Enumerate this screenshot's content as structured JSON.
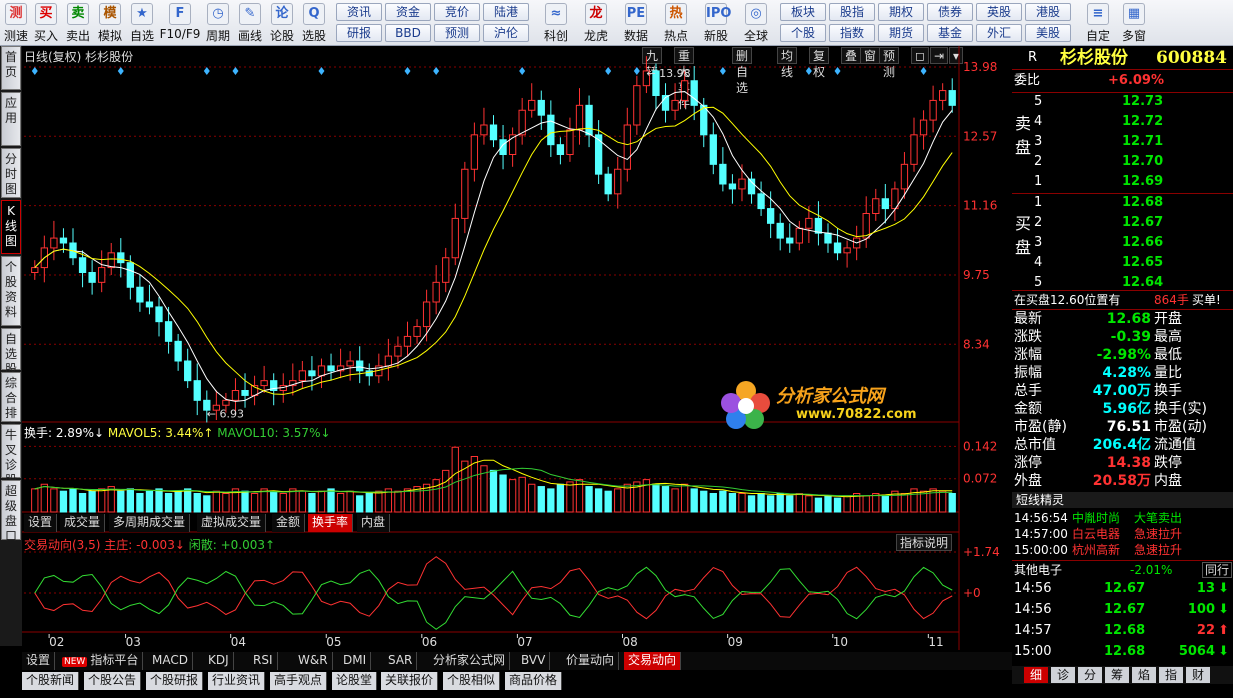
{
  "toolbar": {
    "tools": [
      {
        "icon": "测",
        "label": "测速",
        "color": "#d33"
      },
      {
        "icon": "买",
        "label": "买入",
        "color": "#d00"
      },
      {
        "icon": "卖",
        "label": "卖出",
        "color": "#080"
      },
      {
        "icon": "模",
        "label": "模拟",
        "color": "#a50"
      },
      {
        "icon": "★",
        "label": "自选",
        "color": "#36c"
      },
      {
        "icon": "F",
        "label": "F10/F9",
        "color": "#36c"
      },
      {
        "icon": "◷",
        "label": "周期",
        "color": "#36c"
      },
      {
        "icon": "✎",
        "label": "画线",
        "color": "#36c"
      },
      {
        "icon": "论",
        "label": "论股",
        "color": "#36c"
      },
      {
        "icon": "Q",
        "label": "选股",
        "color": "#36c"
      }
    ],
    "button_grid": [
      [
        "资讯",
        "资金",
        "竞价",
        "陆港"
      ],
      [
        "研报",
        "BBD",
        "预测",
        "沪伦"
      ]
    ],
    "tools2": [
      {
        "icon": "≈",
        "label": "科创",
        "color": "#36c"
      },
      {
        "icon": "龙",
        "label": "龙虎",
        "color": "#c00"
      },
      {
        "icon": "PE",
        "label": "数据",
        "color": "#36c"
      },
      {
        "icon": "热",
        "label": "热点",
        "color": "#c50"
      },
      {
        "icon": "IPO",
        "label": "新股",
        "color": "#36c"
      },
      {
        "icon": "◎",
        "label": "全球",
        "color": "#36c"
      }
    ],
    "button_grid2": [
      [
        "板块",
        "股指",
        "期权",
        "债券",
        "英股",
        "港股"
      ],
      [
        "个股",
        "指数",
        "期货",
        "基金",
        "外汇",
        "美股"
      ]
    ],
    "tools3": [
      {
        "icon": "≡",
        "label": "自定",
        "color": "#36c"
      },
      {
        "icon": "▦",
        "label": "多窗",
        "color": "#36c"
      }
    ]
  },
  "left_tabs": [
    {
      "label": "首页",
      "on": false
    },
    {
      "label": "应用",
      "on": false
    },
    {
      "label": "分时图",
      "on": false
    },
    {
      "label": "K线图",
      "on": true
    },
    {
      "label": "个股资料",
      "on": false
    },
    {
      "label": "自选股",
      "on": false
    },
    {
      "label": "综合排名",
      "on": false
    },
    {
      "label": "牛叉诊股",
      "on": false
    },
    {
      "label": "超级盘口",
      "on": false
    }
  ],
  "chart": {
    "title": "日线(复权) 杉杉股份",
    "top_buttons": [
      "九转",
      "重大事件",
      "删自选",
      "均线",
      "复权",
      "叠",
      "窗",
      "预测",
      "◻",
      "⇥",
      "▾"
    ],
    "price_labels": [
      "13.98",
      "12.57",
      "11.16",
      "9.75",
      "8.34"
    ],
    "max_label": "13.98",
    "min_label": "6.93",
    "vol_header": {
      "a": "换手: 2.89%↓",
      "b": "MAVOL5: 3.44%↑",
      "c": "MAVOL10: 3.57%↓"
    },
    "vol_labels": [
      "0.142",
      "0.072"
    ],
    "mid_tabs": [
      "设置",
      "成交量",
      "多周期成交量",
      "虚拟成交量",
      "金额",
      "换手率",
      "内盘"
    ],
    "mid_active": 5,
    "ind_header": {
      "a": "交易动向(3,5)",
      "b": "主庄: -0.003↓",
      "c": "闲散: +0.003↑"
    },
    "ind_button": "指标说明",
    "ind_labels": [
      "+1.74",
      "+0"
    ],
    "months": [
      "02",
      "03",
      "04",
      "05",
      "06",
      "07",
      "08",
      "09",
      "10",
      "11"
    ],
    "bottom_tabs": [
      "设置",
      "指标平台",
      "MACD",
      "KDJ",
      "RSI",
      "W&R",
      "DMI",
      "SAR",
      "分析家公式网",
      "BVV",
      "价量动向",
      "交易动向"
    ],
    "bottom_active": 11,
    "new_badge": "NEW",
    "news_tabs": [
      "个股新闻",
      "个股公告",
      "个股研报",
      "行业资讯",
      "高手观点",
      "论股堂",
      "关联报价",
      "个股相似",
      "商品价格"
    ],
    "watermark_cn": "分析家公式网",
    "watermark_url": "www.70822.com",
    "candles": [
      9.9,
      10.3,
      10.5,
      10.4,
      10.1,
      9.8,
      9.6,
      9.9,
      10.2,
      10.0,
      9.5,
      9.2,
      9.1,
      8.8,
      8.4,
      8.0,
      7.6,
      7.2,
      7.0,
      7.1,
      7.2,
      7.4,
      7.3,
      7.5,
      7.6,
      7.4,
      7.5,
      7.6,
      7.8,
      7.7,
      7.9,
      7.8,
      7.9,
      8.0,
      7.8,
      7.7,
      7.9,
      8.1,
      8.3,
      8.5,
      8.7,
      9.2,
      9.6,
      10.1,
      10.9,
      11.9,
      12.6,
      12.8,
      12.5,
      12.2,
      12.6,
      13.1,
      13.3,
      13.0,
      12.4,
      12.2,
      12.7,
      13.2,
      12.6,
      11.8,
      11.4,
      11.9,
      12.8,
      13.6,
      13.9,
      13.4,
      13.1,
      13.3,
      13.7,
      13.2,
      12.6,
      12.0,
      11.6,
      11.5,
      11.7,
      11.4,
      11.1,
      10.8,
      10.5,
      10.4,
      10.7,
      10.9,
      10.6,
      10.4,
      10.2,
      10.3,
      10.5,
      11.0,
      11.3,
      11.1,
      11.5,
      12.0,
      12.6,
      12.9,
      13.3,
      13.5,
      13.2
    ],
    "volumes": [
      0.05,
      0.06,
      0.05,
      0.045,
      0.05,
      0.04,
      0.045,
      0.05,
      0.055,
      0.045,
      0.05,
      0.04,
      0.045,
      0.05,
      0.04,
      0.045,
      0.05,
      0.04,
      0.035,
      0.045,
      0.04,
      0.05,
      0.045,
      0.04,
      0.05,
      0.045,
      0.04,
      0.05,
      0.045,
      0.04,
      0.045,
      0.05,
      0.04,
      0.045,
      0.035,
      0.04,
      0.045,
      0.05,
      0.045,
      0.05,
      0.055,
      0.06,
      0.07,
      0.09,
      0.14,
      0.11,
      0.12,
      0.1,
      0.09,
      0.08,
      0.07,
      0.075,
      0.06,
      0.055,
      0.05,
      0.06,
      0.065,
      0.07,
      0.055,
      0.05,
      0.045,
      0.05,
      0.06,
      0.065,
      0.07,
      0.06,
      0.055,
      0.05,
      0.06,
      0.05,
      0.045,
      0.04,
      0.045,
      0.04,
      0.04,
      0.035,
      0.04,
      0.035,
      0.04,
      0.035,
      0.04,
      0.035,
      0.03,
      0.035,
      0.03,
      0.035,
      0.04,
      0.035,
      0.04,
      0.035,
      0.045,
      0.04,
      0.05,
      0.045,
      0.05,
      0.045,
      0.04
    ]
  },
  "quote": {
    "stock_name": "杉杉股份",
    "stock_code": "600884",
    "badge": "R",
    "weibi_label": "委比",
    "weibi": "+6.09%",
    "sell_label": "卖盘",
    "buy_label": "买盘",
    "sell": [
      {
        "n": "5",
        "p": "12.73"
      },
      {
        "n": "4",
        "p": "12.72"
      },
      {
        "n": "3",
        "p": "12.71"
      },
      {
        "n": "2",
        "p": "12.70"
      },
      {
        "n": "1",
        "p": "12.69"
      }
    ],
    "buy": [
      {
        "n": "1",
        "p": "12.68"
      },
      {
        "n": "2",
        "p": "12.67"
      },
      {
        "n": "3",
        "p": "12.66"
      },
      {
        "n": "4",
        "p": "12.65"
      },
      {
        "n": "5",
        "p": "12.64"
      }
    ],
    "notice_a": "在买盘12.60位置有",
    "notice_b": "864手",
    "notice_c": "买单!",
    "stats": [
      {
        "l": "最新",
        "v": "12.68",
        "c": "green",
        "l2": "开盘"
      },
      {
        "l": "涨跌",
        "v": "-0.39",
        "c": "green",
        "l2": "最高"
      },
      {
        "l": "涨幅",
        "v": "-2.98%",
        "c": "green",
        "l2": "最低"
      },
      {
        "l": "振幅",
        "v": "4.28%",
        "c": "cyan",
        "l2": "量比"
      },
      {
        "l": "总手",
        "v": "47.00万",
        "c": "cyan",
        "l2": "换手"
      },
      {
        "l": "金额",
        "v": "5.96亿",
        "c": "cyan",
        "l2": "换手(实)"
      },
      {
        "l": "市盈(静)",
        "v": "76.51",
        "c": "white",
        "l2": "市盈(动)"
      },
      {
        "l": "总市值",
        "v": "206.4亿",
        "c": "cyan",
        "l2": "流通值"
      },
      {
        "l": "涨停",
        "v": "14.38",
        "c": "red",
        "l2": "跌停"
      },
      {
        "l": "外盘",
        "v": "20.58万",
        "c": "red",
        "l2": "内盘"
      }
    ],
    "sprite_title": "短线精灵",
    "sprite": [
      {
        "t": "14:56:54",
        "n": "中胤时尚",
        "e": "大笔卖出",
        "c": "green"
      },
      {
        "t": "14:57:00",
        "n": "白云电器",
        "e": "急速拉升",
        "c": "red"
      },
      {
        "t": "15:00:00",
        "n": "杭州高新",
        "e": "急速拉升",
        "c": "red"
      }
    ],
    "sector_name": "其他电子",
    "sector_pct": "-2.01%",
    "sector_btn": "同行",
    "ticks": [
      {
        "t": "14:56",
        "p": "12.67",
        "v": "13",
        "d": "down"
      },
      {
        "t": "14:56",
        "p": "12.67",
        "v": "100",
        "d": "down"
      },
      {
        "t": "14:57",
        "p": "12.68",
        "v": "22",
        "d": "up"
      },
      {
        "t": "15:00",
        "p": "12.68",
        "v": "5064",
        "d": "down"
      }
    ],
    "bottom_tabs": [
      "细",
      "诊",
      "分",
      "筹",
      "焰",
      "指",
      "财"
    ]
  },
  "colors": {
    "up": "#ff3232",
    "down": "#54ffff",
    "grid": "#8a0000",
    "bg": "#000000"
  }
}
